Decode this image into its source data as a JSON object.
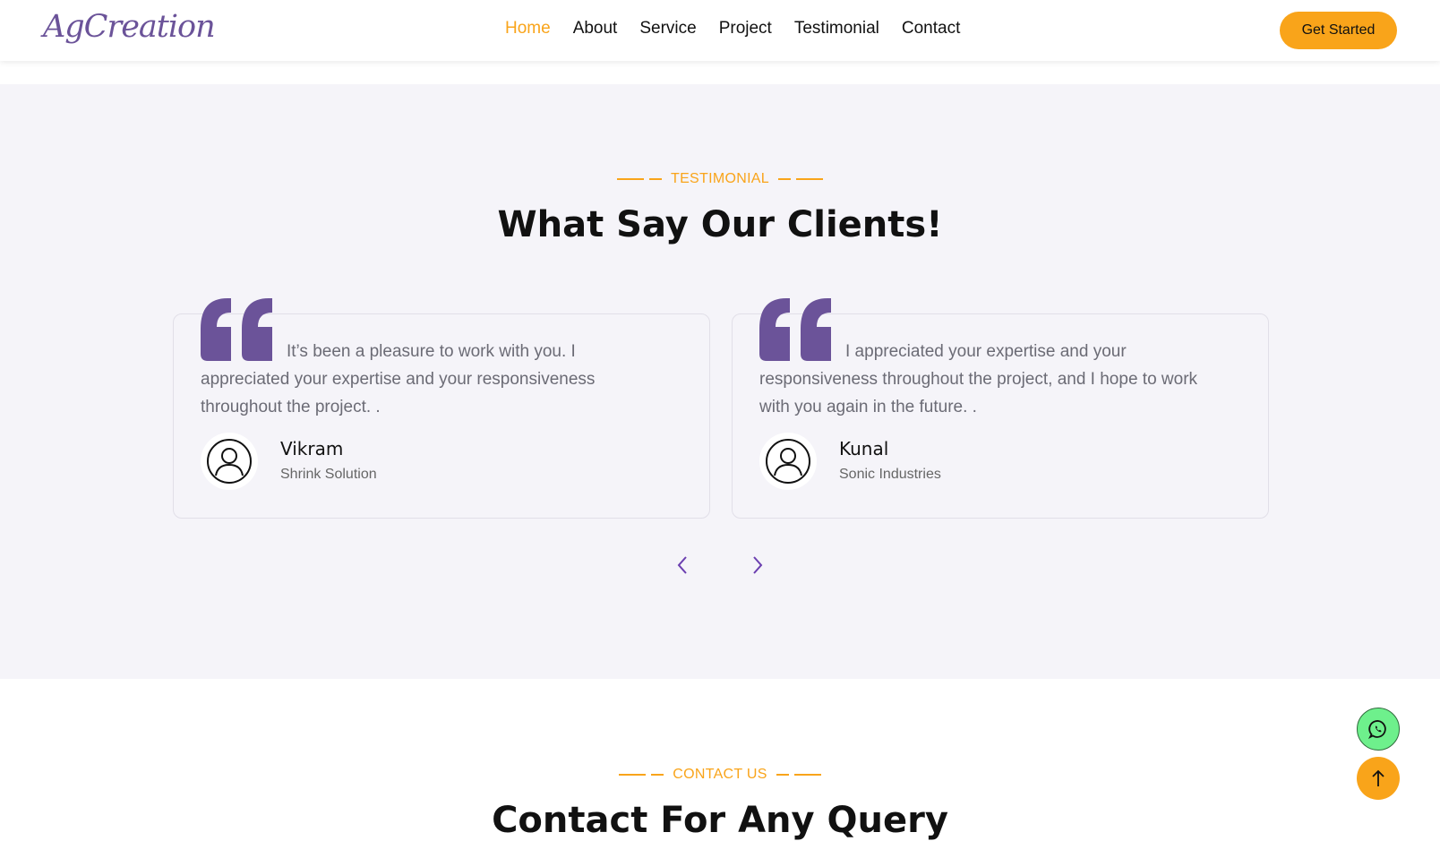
{
  "brand": {
    "logo_text": "AgCreation"
  },
  "nav": {
    "items": [
      {
        "label": "Home",
        "active": true
      },
      {
        "label": "About",
        "active": false
      },
      {
        "label": "Service",
        "active": false
      },
      {
        "label": "Project",
        "active": false
      },
      {
        "label": "Testimonial",
        "active": false
      },
      {
        "label": "Contact",
        "active": false
      }
    ],
    "cta_label": "Get Started"
  },
  "testimonial_section": {
    "subtitle": "TESTIMONIAL",
    "title": "What Say Our Clients!",
    "items": [
      {
        "quote": "It’s been a pleasure to work with you. I appreciated your expertise and your responsiveness throughout the project. .",
        "name": "Vikram",
        "company": "Shrink Solution"
      },
      {
        "quote": "I appreciated your expertise and your responsiveness throughout the project, and I hope to work with you again in the future. .",
        "name": "Kunal",
        "company": "Sonic Industries"
      }
    ],
    "prev_icon": "chevron-left-icon",
    "next_icon": "chevron-right-icon"
  },
  "contact_section": {
    "subtitle": "CONTACT US",
    "title": "Contact For Any Query"
  },
  "floating": {
    "whatsapp_icon": "whatsapp-icon",
    "scroll_top_icon": "arrow-up-icon"
  },
  "colors": {
    "accent": "#f9a41a",
    "brand": "#6b5399",
    "section_bg": "#f5f4f9"
  }
}
